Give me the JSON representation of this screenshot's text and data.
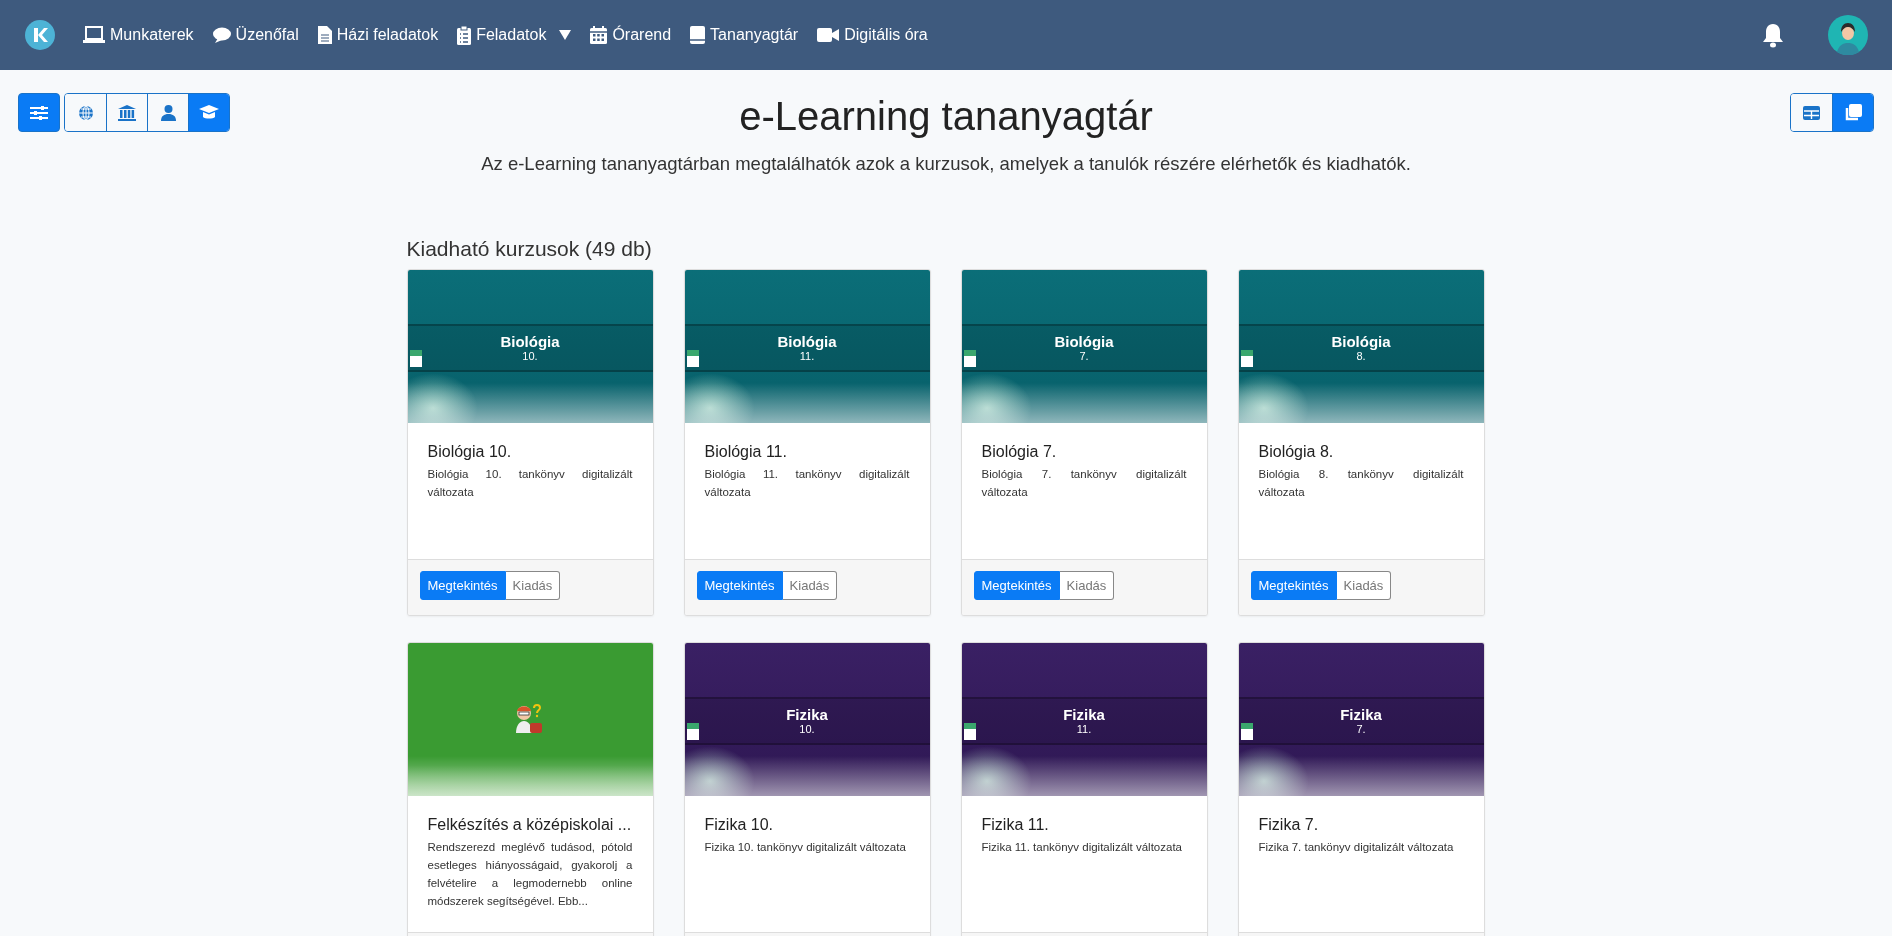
{
  "nav": {
    "items": [
      {
        "label": "Munkaterek"
      },
      {
        "label": "Üzenőfal"
      },
      {
        "label": "Házi feladatok"
      },
      {
        "label": "Feladatok",
        "dropdown": true
      },
      {
        "label": "Órarend"
      },
      {
        "label": "Tananyagtár"
      },
      {
        "label": "Digitális óra"
      }
    ]
  },
  "filter_toolbar": {
    "filter_selected": true,
    "scopes": [
      {
        "selected": false
      },
      {
        "selected": false
      },
      {
        "selected": false
      },
      {
        "selected": true
      }
    ]
  },
  "view_toggle": [
    {
      "selected": false
    },
    {
      "selected": true
    }
  ],
  "title": "e-Learning tananyagtár",
  "subtitle": "Az e-Learning tananyagtárban megtalálhatók azok a kurzusok, amelyek a tanulók részére elérhetők és kiadhatók.",
  "section_title": "Kiadható kurzusok (49 db)",
  "courses": [
    {
      "cover": {
        "kind": "teal",
        "title": "Biológia",
        "number": "10."
      },
      "title": "Biológia 10.",
      "description": "Biológia 10. tankönyv digitalizált változata",
      "actions": [
        {
          "label": "Megtekintés",
          "primary": true
        },
        {
          "label": "Kiadás",
          "primary": false
        }
      ]
    },
    {
      "cover": {
        "kind": "teal",
        "title": "Biológia",
        "number": "11."
      },
      "title": "Biológia 11.",
      "description": "Biológia 11. tankönyv digitalizált változata",
      "actions": [
        {
          "label": "Megtekintés",
          "primary": true
        },
        {
          "label": "Kiadás",
          "primary": false
        }
      ]
    },
    {
      "cover": {
        "kind": "teal",
        "title": "Biológia",
        "number": "7."
      },
      "title": "Biológia 7.",
      "description": "Biológia 7. tankönyv digitalizált változata",
      "actions": [
        {
          "label": "Megtekintés",
          "primary": true
        },
        {
          "label": "Kiadás",
          "primary": false
        }
      ]
    },
    {
      "cover": {
        "kind": "teal",
        "title": "Biológia",
        "number": "8."
      },
      "title": "Biológia 8.",
      "description": "Biológia 8. tankönyv digitalizált változata",
      "actions": [
        {
          "label": "Megtekintés",
          "primary": true
        },
        {
          "label": "Kiadás",
          "primary": false
        }
      ]
    },
    {
      "cover": {
        "kind": "green"
      },
      "title": "Felkészítés a középiskolai ...",
      "description": "Rendszerezd meglévő tudásod, pótold esetleges hiányosságaid, gyakorolj a felvételire a legmodernebb online módszerek segítségével. Ebb..."
    },
    {
      "cover": {
        "kind": "purple",
        "title": "Fizika",
        "number": "10."
      },
      "title": "Fizika 10.",
      "description": "Fizika 10. tankönyv digitalizált változata"
    },
    {
      "cover": {
        "kind": "purple",
        "title": "Fizika",
        "number": "11."
      },
      "title": "Fizika 11.",
      "description": "Fizika 11. tankönyv digitalizált változata"
    },
    {
      "cover": {
        "kind": "purple",
        "title": "Fizika",
        "number": "7."
      },
      "title": "Fizika 7.",
      "description": "Fizika 7. tankönyv digitalizált változata"
    }
  ]
}
